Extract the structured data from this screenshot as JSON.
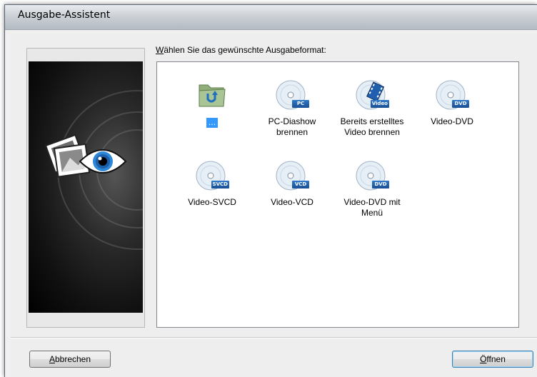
{
  "window": {
    "title": "Ausgabe-Assistent"
  },
  "prompt": {
    "mnemonic": "W",
    "rest": "ählen Sie das gewünschte Ausgabeformat:"
  },
  "items": [
    {
      "label": "...",
      "icon": "folder-up-icon",
      "selected": true
    },
    {
      "label_line1": "PC-Diashow",
      "label_line2": "brennen",
      "badge": "PC",
      "icon": "disc-icon"
    },
    {
      "label_line1": "Bereits erstelltes",
      "label_line2": "Video brennen",
      "badge": "Video",
      "icon": "disc-film-icon"
    },
    {
      "label_line1": "Video-DVD",
      "label_line2": "",
      "badge": "DVD",
      "icon": "disc-icon"
    },
    {
      "label_line1": "Video-SVCD",
      "label_line2": "",
      "badge": "SVCD",
      "icon": "disc-icon"
    },
    {
      "label_line1": "Video-VCD",
      "label_line2": "",
      "badge": "VCD",
      "icon": "disc-icon"
    },
    {
      "label_line1": "Video-DVD mit",
      "label_line2": "Menü",
      "badge": "DVD",
      "icon": "disc-icon"
    }
  ],
  "buttons": {
    "cancel": {
      "mnemonic": "A",
      "rest": "bbrechen"
    },
    "open": {
      "mnemonic": "Ö",
      "rest": "ffnen"
    }
  },
  "colors": {
    "selection": "#3399ff",
    "badge_blue": "#1f5fae",
    "folder_green": "#9fbf8a",
    "eye_blue": "#2e86d6"
  }
}
